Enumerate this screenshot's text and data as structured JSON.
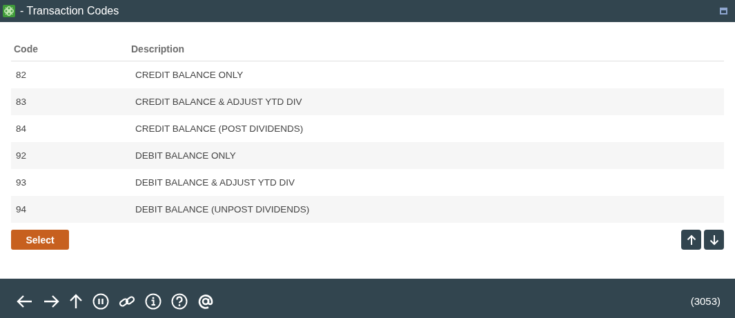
{
  "window": {
    "title": "- Transaction Codes"
  },
  "table": {
    "columns": [
      "Code",
      "Description"
    ],
    "rows": [
      {
        "code": "82",
        "description": "CREDIT BALANCE ONLY"
      },
      {
        "code": "83",
        "description": "CREDIT BALANCE & ADJUST YTD DIV"
      },
      {
        "code": "84",
        "description": "CREDIT BALANCE (POST DIVIDENDS)"
      },
      {
        "code": "92",
        "description": "DEBIT BALANCE ONLY"
      },
      {
        "code": "93",
        "description": "DEBIT BALANCE & ADJUST YTD DIV"
      },
      {
        "code": "94",
        "description": "DEBIT BALANCE (UNPOST DIVIDENDS)"
      }
    ]
  },
  "select_button": "Select",
  "status_bar": {
    "count": "(3053)"
  }
}
